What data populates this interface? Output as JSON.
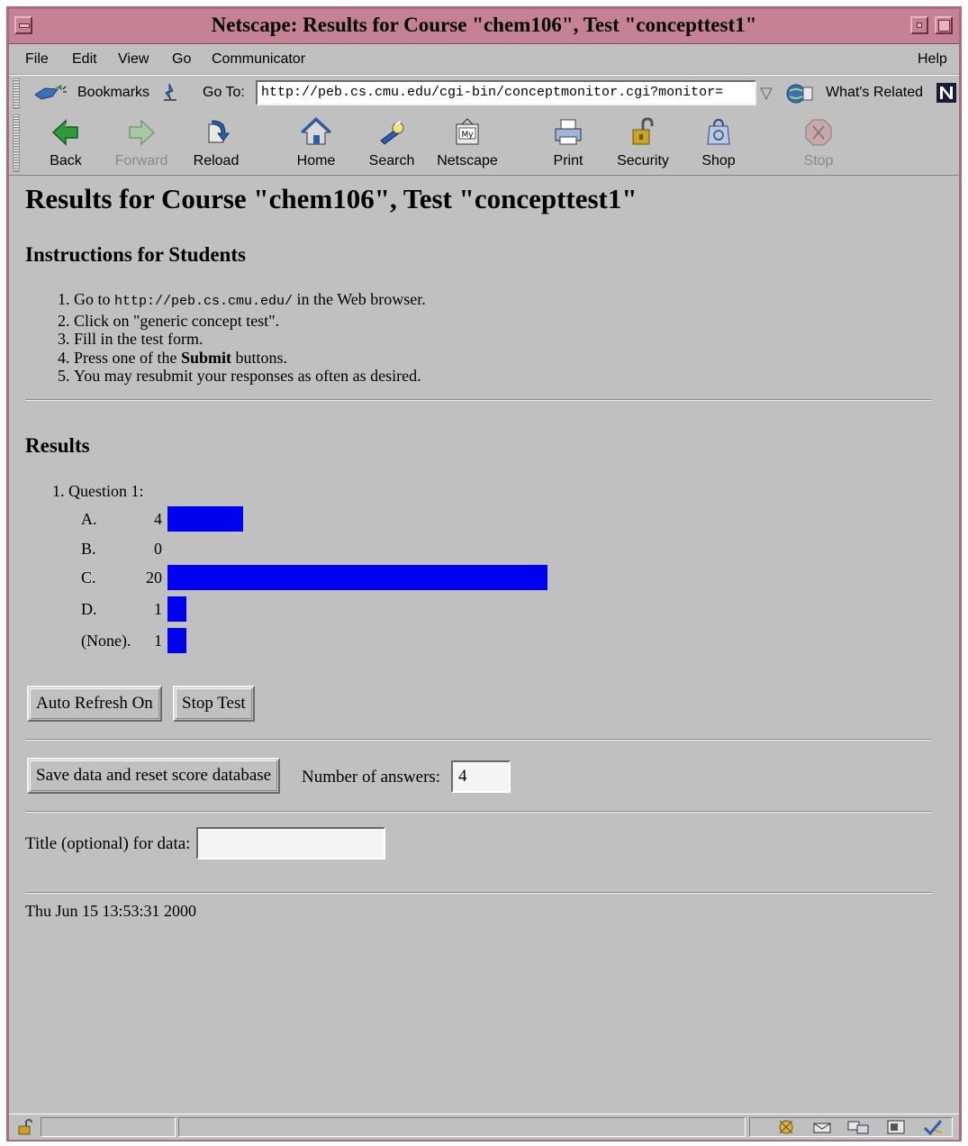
{
  "window": {
    "title": "Netscape: Results for Course \"chem106\", Test \"concepttest1\""
  },
  "menubar": {
    "items": [
      "File",
      "Edit",
      "View",
      "Go",
      "Communicator"
    ],
    "help": "Help"
  },
  "location": {
    "bookmarks_label": "Bookmarks",
    "goto_label": "Go To:",
    "url": "http://peb.cs.cmu.edu/cgi-bin/conceptmonitor.cgi?monitor=",
    "whats_related": "What's Related"
  },
  "toolbar": {
    "buttons": [
      {
        "label": "Back",
        "icon": "back-arrow-icon",
        "enabled": true
      },
      {
        "label": "Forward",
        "icon": "forward-arrow-icon",
        "enabled": false
      },
      {
        "label": "Reload",
        "icon": "reload-icon",
        "enabled": true
      },
      {
        "label": "Home",
        "icon": "home-icon",
        "enabled": true
      },
      {
        "label": "Search",
        "icon": "search-icon",
        "enabled": true
      },
      {
        "label": "Netscape",
        "icon": "my-netscape-icon",
        "enabled": true
      },
      {
        "label": "Print",
        "icon": "printer-icon",
        "enabled": true
      },
      {
        "label": "Security",
        "icon": "padlock-icon",
        "enabled": true
      },
      {
        "label": "Shop",
        "icon": "shop-bag-icon",
        "enabled": true
      },
      {
        "label": "Stop",
        "icon": "stop-icon",
        "enabled": false
      }
    ]
  },
  "page": {
    "title": "Results for Course \"chem106\", Test \"concepttest1\"",
    "instructions_heading": "Instructions for Students",
    "instructions": {
      "step1_prefix": "Go to ",
      "step1_url": "http://peb.cs.cmu.edu/",
      "step1_suffix": " in the Web browser.",
      "step2": "Click on \"generic concept test\".",
      "step3": "Fill in the test form.",
      "step4_prefix": "Press one of the ",
      "step4_bold": "Submit",
      "step4_suffix": " buttons.",
      "step5": "You may resubmit your responses as often as desired."
    },
    "results_heading": "Results",
    "question_label": "1. Question 1:",
    "buttons": {
      "auto_refresh": "Auto Refresh On",
      "stop_test": "Stop Test",
      "save_reset": "Save data and reset score database"
    },
    "number_of_answers_label": "Number of answers:",
    "number_of_answers_value": "4",
    "title_label": "Title (optional) for data:",
    "title_value": "",
    "timestamp": "Thu Jun 15 13:53:31 2000"
  },
  "chart_data": {
    "type": "bar",
    "orientation": "horizontal",
    "categories": [
      "A.",
      "B.",
      "C.",
      "D.",
      "(None)."
    ],
    "values": [
      4,
      0,
      20,
      1,
      1
    ],
    "bar_color": "#0000f0"
  },
  "colors": {
    "title_bar": "#c58297",
    "chrome": "#c0c0c0",
    "bar": "#0000f0"
  }
}
